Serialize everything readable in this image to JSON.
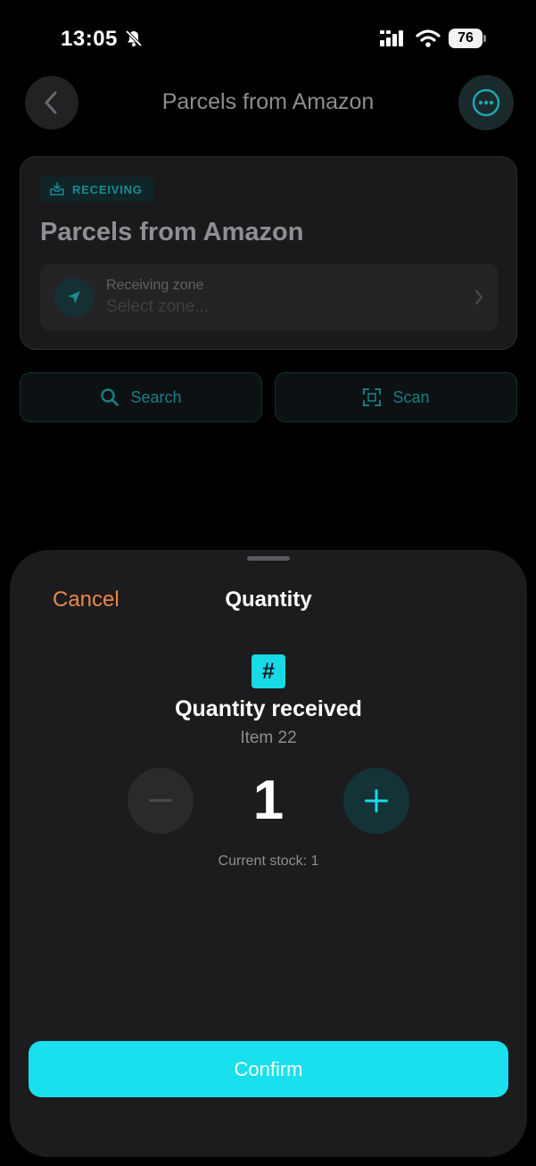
{
  "status_bar": {
    "time": "13:05",
    "battery": "76"
  },
  "background_page": {
    "title": "Parcels from Amazon",
    "card": {
      "badge": "RECEIVING",
      "title": "Parcels from Amazon",
      "zone": {
        "label": "Receiving zone",
        "value": "Select zone..."
      }
    },
    "actions": {
      "search_label": "Search",
      "scan_label": "Scan"
    }
  },
  "sheet": {
    "cancel_label": "Cancel",
    "title": "Quantity",
    "icon": "#",
    "heading": "Quantity received",
    "item": "Item 22",
    "quantity": "1",
    "stock_text": "Current stock: 1",
    "confirm_label": "Confirm"
  },
  "colors": {
    "accent": "#19e0ec",
    "cancel": "#e8884a",
    "sheet_bg": "#1c1c1e"
  }
}
